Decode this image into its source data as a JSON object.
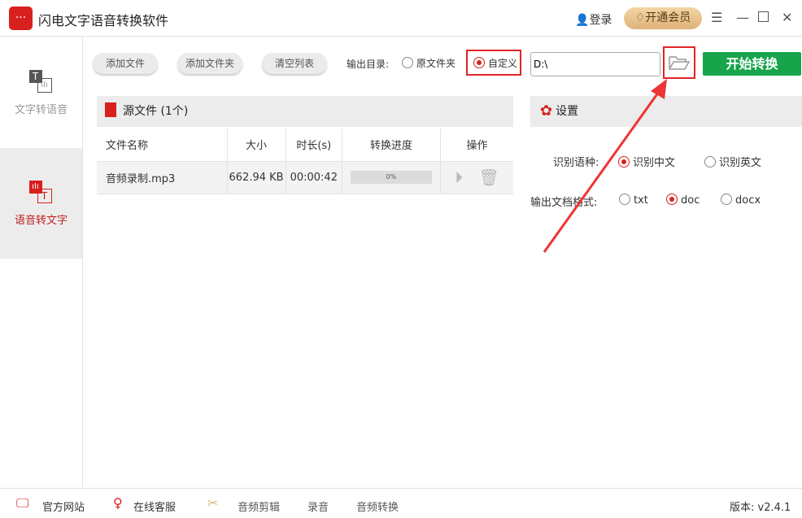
{
  "app": {
    "title": "闪电文字语音转换软件",
    "logo_text": "···",
    "login": "登录",
    "vip": "开通会员"
  },
  "sidebar": {
    "items": [
      {
        "label": "文字转语音"
      },
      {
        "label": "语音转文字"
      }
    ]
  },
  "toolbar": {
    "add_file": "添加文件",
    "add_folder": "添加文件夹",
    "clear_list": "清空列表",
    "output_label": "输出目录:",
    "opt_source": "原文件夹",
    "opt_custom": "自定义",
    "path": "D:\\",
    "start": "开始转换"
  },
  "files": {
    "header": "源文件 (1个)",
    "columns": [
      "文件名称",
      "大小",
      "时长(s)",
      "转换进度",
      "操作"
    ],
    "rows": [
      {
        "name": "音频录制.mp3",
        "size": "662.94 KB",
        "duration": "00:00:42",
        "progress": "0%"
      }
    ]
  },
  "settings": {
    "header": "设置",
    "lang_label": "识别语种:",
    "lang_options": [
      "识别中文",
      "识别英文"
    ],
    "format_label": "输出文档格式:",
    "format_options": [
      "txt",
      "doc",
      "docx"
    ]
  },
  "footer": {
    "website": "官方网站",
    "support": "在线客服",
    "edit": "音频剪辑",
    "record": "录音",
    "convert": "音频转换",
    "version": "版本: v2.4.1"
  },
  "colors": {
    "accent": "#d8201f",
    "start": "#17a44b"
  }
}
